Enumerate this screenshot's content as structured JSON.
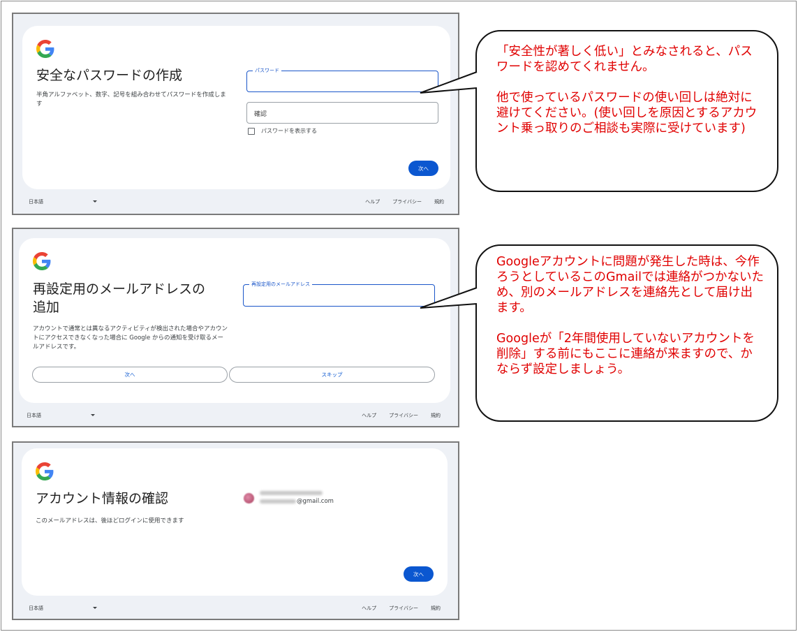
{
  "screen1": {
    "title": "安全なパスワードの作成",
    "description": "半角アルファベット、数字、記号を組み合わせてパスワードを作成します",
    "password_label": "パスワード",
    "confirm_placeholder": "確認",
    "show_password_label": "パスワードを表示する",
    "next_label": "次へ"
  },
  "screen2": {
    "title_line1": "再設定用のメールアドレスの",
    "title_line2": "追加",
    "recovery_label": "再設定用のメールアドレス",
    "description": "アカウントで通常とは異なるアクティビティが検出された場合やアカウントにアクセスできなくなった場合に Google からの通知を受け取るメールアドレスです。",
    "next_label": "次へ",
    "skip_label": "スキップ"
  },
  "screen3": {
    "title": "アカウント情報の確認",
    "description": "このメールアドレスは、後ほどログインに使用できます",
    "email_suffix": "@gmail.com",
    "next_label": "次へ"
  },
  "footer": {
    "language": "日本語",
    "help": "ヘルプ",
    "privacy": "プライバシー",
    "terms": "規約"
  },
  "callout1": {
    "para1": "「安全性が著しく低い」とみなされると、パスワードを認めてくれません。",
    "para2": "他で使っているパスワードの使い回しは絶対に避けてください。(使い回しを原因とするアカウント乗っ取りのご相談も実際に受けています)"
  },
  "callout2": {
    "para1": "Googleアカウントに問題が発生した時は、今作ろうとしているこのGmailでは連絡がつかないため、別のメールアドレスを連絡先として届け出ます。",
    "para2": "Googleが「2年間使用していないアカウントを削除」する前にもここに連絡が来ますので、かならず設定しましょう。"
  },
  "colors": {
    "callout_text": "#e00000",
    "google_blue": "#0b57d0"
  },
  "icons": [
    "google-g-icon",
    "checkbox-icon",
    "chevron-down-icon"
  ]
}
